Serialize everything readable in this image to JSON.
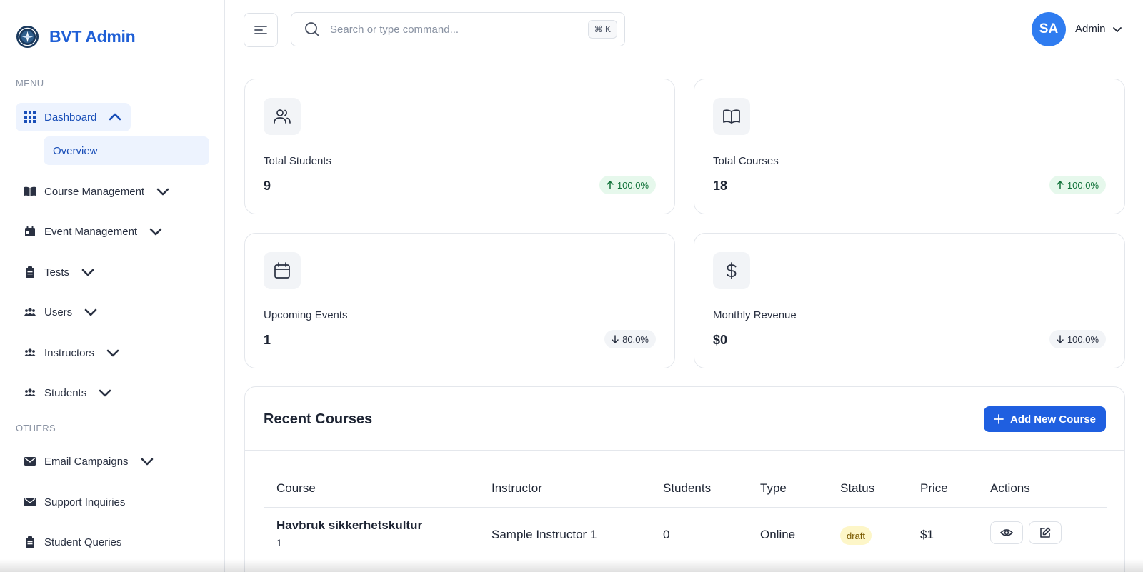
{
  "brand": {
    "name": "BVT Admin"
  },
  "sidebar": {
    "menu_label": "MENU",
    "others_label": "OTHERS",
    "dashboard": {
      "label": "Dashboard",
      "sub_overview": "Overview"
    },
    "items": [
      {
        "label": "Course Management"
      },
      {
        "label": "Event Management"
      },
      {
        "label": "Tests"
      },
      {
        "label": "Users"
      },
      {
        "label": "Instructors"
      },
      {
        "label": "Students"
      }
    ],
    "others": [
      {
        "label": "Email Campaigns"
      },
      {
        "label": "Support Inquiries"
      },
      {
        "label": "Student Queries"
      }
    ]
  },
  "topbar": {
    "search_placeholder": "Search or type command...",
    "shortcut": "⌘ K",
    "avatar_initials": "SA",
    "user_name": "Admin"
  },
  "stats": [
    {
      "label": "Total Students",
      "value": "9",
      "change": "100.0%",
      "trend": "up"
    },
    {
      "label": "Total Courses",
      "value": "18",
      "change": "100.0%",
      "trend": "up"
    },
    {
      "label": "Upcoming Events",
      "value": "1",
      "change": "80.0%",
      "trend": "down"
    },
    {
      "label": "Monthly Revenue",
      "value": "$0",
      "change": "100.0%",
      "trend": "down"
    }
  ],
  "recent": {
    "title": "Recent Courses",
    "add_label": "Add New Course",
    "columns": [
      "Course",
      "Instructor",
      "Students",
      "Type",
      "Status",
      "Price",
      "Actions"
    ],
    "rows": [
      {
        "course": "Havbruk sikkerhetskultur",
        "course_sub": "1",
        "instructor": "Sample Instructor 1",
        "students": "0",
        "type": "Online",
        "status": "draft",
        "price": "$1"
      }
    ]
  },
  "colors": {
    "accent": "#1f5fe0",
    "brand": "#1f5fd6",
    "up_badge": "#e6f8ec",
    "draft_badge": "#fdf6c8"
  }
}
